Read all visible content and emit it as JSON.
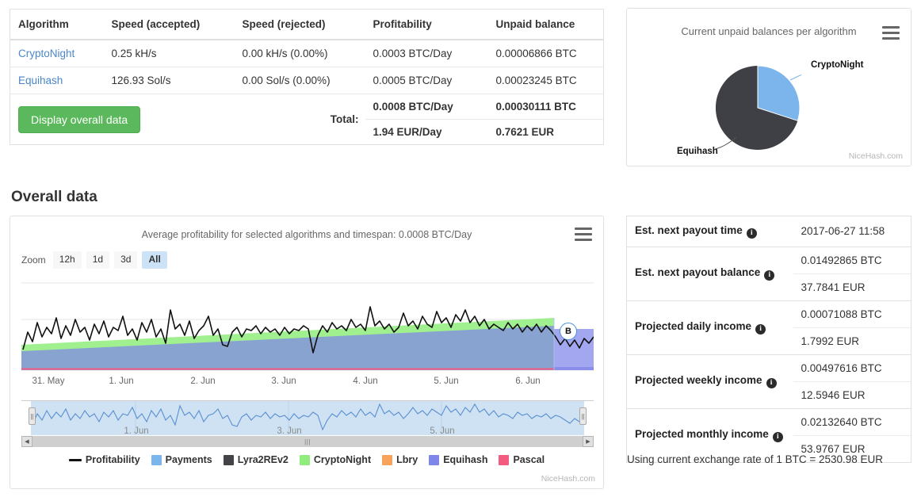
{
  "algo_table": {
    "headers": [
      "Algorithm",
      "Speed (accepted)",
      "Speed (rejected)",
      "Profitability",
      "Unpaid balance"
    ],
    "rows": [
      {
        "algorithm": "CryptoNight",
        "speed_accepted": "0.25 kH/s",
        "speed_rejected": "0.00 kH/s (0.00%)",
        "profitability": "0.0003 BTC/Day",
        "unpaid_balance": "0.00006866 BTC"
      },
      {
        "algorithm": "Equihash",
        "speed_accepted": "126.93 Sol/s",
        "speed_rejected": "0.00 Sol/s (0.00%)",
        "profitability": "0.0005 BTC/Day",
        "unpaid_balance": "0.00023245 BTC"
      }
    ],
    "display_button": "Display overall data",
    "total_label": "Total:",
    "total_profitability_btc": "0.0008 BTC/Day",
    "total_profitability_eur": "1.94 EUR/Day",
    "total_unpaid_btc": "0.00030111 BTC",
    "total_unpaid_eur": "0.7621 EUR"
  },
  "pie_card": {
    "title": "Current unpaid balances per algorithm",
    "menu_icon": "hamburger-menu-icon",
    "watermark": "NiceHash.com",
    "label_cryptonight": "CryptoNight",
    "label_equihash": "Equihash"
  },
  "section": {
    "overall_data_heading": "Overall data"
  },
  "chart_card": {
    "title": "Average profitability for selected algorithms and timespan: 0.0008 BTC/Day",
    "menu_icon": "hamburger-menu-icon",
    "watermark": "NiceHash.com",
    "zoom_label": "Zoom",
    "zoom_buttons": [
      {
        "label": "12h",
        "active": false
      },
      {
        "label": "1d",
        "active": false
      },
      {
        "label": "3d",
        "active": false
      },
      {
        "label": "All",
        "active": true
      }
    ],
    "flag_label": "B",
    "scroll_left_icon": "caret-left-icon",
    "scroll_right_icon": "caret-right-icon"
  },
  "payout": {
    "rows": [
      {
        "label": "Est. next payout time",
        "value_primary": "2017-06-27 11:58",
        "value_secondary": null
      },
      {
        "label": "Est. next payout balance",
        "value_primary": "0.01492865 BTC",
        "value_secondary": "37.7841 EUR"
      },
      {
        "label": "Projected daily income",
        "value_primary": "0.00071088 BTC",
        "value_secondary": "1.7992 EUR"
      },
      {
        "label": "Projected weekly income",
        "value_primary": "0.00497616 BTC",
        "value_secondary": "12.5946 EUR"
      },
      {
        "label": "Projected monthly income",
        "value_primary": "0.02132640 BTC",
        "value_secondary": "53.9767 EUR"
      }
    ],
    "info_icon": "info-icon",
    "exchange_rate_note": "Using current exchange rate of 1 BTC = 2530.98 EUR"
  },
  "colors": {
    "accent_green": "#5cb85c",
    "link_blue": "#4a86c8",
    "payments": "#7cb5ec",
    "lyra2rev2": "#434348",
    "cryptonight": "#90ed7d",
    "lbry": "#f7a35c",
    "equihash": "#8085e9",
    "pascal": "#f15c80",
    "profitability_line": "#111111",
    "zoom_active_bg": "#cce3f7"
  },
  "chart_data": [
    {
      "type": "pie",
      "title": "Current unpaid balances per algorithm",
      "labels": [
        "CryptoNight",
        "Equihash"
      ],
      "values": [
        6.866e-05,
        0.00023245
      ],
      "percentages": [
        22.8,
        77.2
      ],
      "colors": [
        "#7cb5ec",
        "#3f3f46"
      ],
      "legend": "data-labels-with-connectors"
    },
    {
      "type": "area",
      "title": "Average profitability for selected algorithms and timespan: 0.0008 BTC/Day",
      "xlabel": "",
      "ylabel": "",
      "grid": true,
      "legend_position": "bottom",
      "x_tick_labels": [
        "31. May",
        "1. Jun",
        "2. Jun",
        "3. Jun",
        "4. Jun",
        "5. Jun",
        "6. Jun"
      ],
      "navigator_tick_labels": [
        "1. Jun",
        "3. Jun",
        "5. Jun"
      ],
      "annotations": [
        {
          "label": "B",
          "x_fraction": 0.95
        }
      ],
      "series": [
        {
          "name": "Profitability",
          "type": "line",
          "color": "#111111",
          "values": [
            0.22,
            0.55,
            0.38,
            0.7,
            0.44,
            0.62,
            0.5,
            0.78,
            0.42,
            0.66,
            0.52,
            0.74,
            0.46,
            0.6,
            0.36,
            0.68,
            0.48,
            0.72,
            0.4,
            0.64,
            0.54,
            0.8,
            0.45,
            0.58,
            0.38,
            0.69,
            0.5,
            0.76,
            0.43,
            0.61,
            0.35,
            0.88,
            0.52,
            0.7,
            0.47,
            0.73,
            0.41,
            0.65,
            0.56,
            0.79,
            0.44,
            0.59,
            0.33,
            0.3,
            0.48,
            0.55,
            0.42,
            0.58,
            0.5,
            0.62,
            0.46,
            0.57,
            0.44,
            0.6,
            0.49,
            0.54,
            0.38,
            0.52,
            0.47,
            0.61,
            0.43,
            0.56,
            0.51,
            0.58,
            0.2,
            0.45,
            0.62,
            0.49,
            0.66,
            0.54,
            0.6,
            0.48,
            0.7,
            0.55,
            0.63,
            0.5,
            0.84,
            0.58,
            0.66,
            0.52,
            0.62,
            0.45,
            0.57,
            0.72,
            0.53,
            0.64,
            0.5,
            0.68,
            0.56,
            0.6,
            0.74,
            0.58,
            0.66,
            0.52,
            0.7,
            0.62,
            0.76,
            0.59,
            0.68,
            0.55,
            0.64,
            0.48,
            0.57,
            0.52,
            0.46,
            0.58,
            0.5,
            0.55,
            0.43,
            0.52,
            0.47,
            0.56,
            0.44,
            0.53
          ]
        },
        {
          "name": "Payments",
          "type": "area",
          "color": "#7cb5ec",
          "values": []
        },
        {
          "name": "Lyra2REv2",
          "type": "area",
          "color": "#434348",
          "values": []
        },
        {
          "name": "CryptoNight",
          "type": "area",
          "color": "#90ed7d",
          "description": "upper band, grows from ~0.30 to ~0.60 of plot height left-to-right"
        },
        {
          "name": "Lbry",
          "type": "area",
          "color": "#f7a35c",
          "values": []
        },
        {
          "name": "Equihash",
          "type": "area",
          "color": "#8085e9",
          "description": "lower stacked band, grows from ~0.24 to ~0.55 of plot height left-to-right"
        },
        {
          "name": "Pascal",
          "type": "area",
          "color": "#f15c80",
          "description": "thin sliver along the baseline"
        }
      ]
    }
  ]
}
